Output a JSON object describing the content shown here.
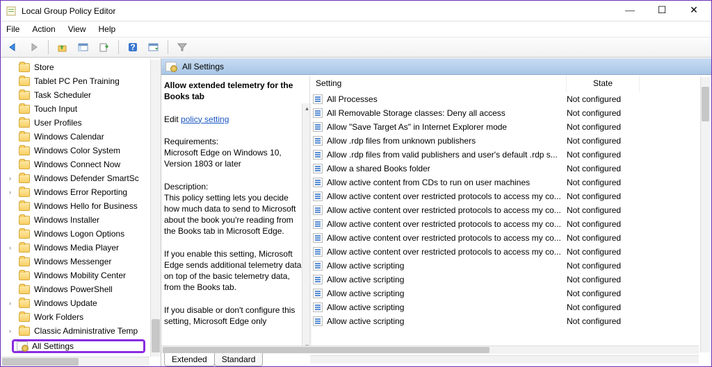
{
  "window": {
    "title": "Local Group Policy Editor"
  },
  "menu": {
    "file": "File",
    "action": "Action",
    "view": "View",
    "help": "Help"
  },
  "tree": {
    "items": [
      {
        "label": "Store",
        "exp": ""
      },
      {
        "label": "Tablet PC Pen Training",
        "exp": ""
      },
      {
        "label": "Task Scheduler",
        "exp": ""
      },
      {
        "label": "Touch Input",
        "exp": ""
      },
      {
        "label": "User Profiles",
        "exp": ""
      },
      {
        "label": "Windows Calendar",
        "exp": ""
      },
      {
        "label": "Windows Color System",
        "exp": ""
      },
      {
        "label": "Windows Connect Now",
        "exp": ""
      },
      {
        "label": "Windows Defender SmartSc",
        "exp": "›"
      },
      {
        "label": "Windows Error Reporting",
        "exp": "›"
      },
      {
        "label": "Windows Hello for Business",
        "exp": ""
      },
      {
        "label": "Windows Installer",
        "exp": ""
      },
      {
        "label": "Windows Logon Options",
        "exp": ""
      },
      {
        "label": "Windows Media Player",
        "exp": "›"
      },
      {
        "label": "Windows Messenger",
        "exp": ""
      },
      {
        "label": "Windows Mobility Center",
        "exp": ""
      },
      {
        "label": "Windows PowerShell",
        "exp": ""
      },
      {
        "label": "Windows Update",
        "exp": "›"
      },
      {
        "label": "Work Folders",
        "exp": ""
      },
      {
        "label": "Classic Administrative Temp",
        "exp": "›"
      }
    ],
    "selected": "All Settings"
  },
  "header": {
    "title": "All Settings"
  },
  "desc": {
    "policy_heading": "Allow extended telemetry for the Books tab",
    "edit_prefix": "Edit ",
    "edit_link": "policy setting",
    "req_label": "Requirements:",
    "req_text": "Microsoft Edge on Windows 10, Version 1803 or later",
    "desc_label": "Description:",
    "desc_text1": "This policy setting lets you decide how much data to send to Microsoft about the book you're reading from the Books tab in Microsoft Edge.",
    "desc_text2": "If you enable this setting, Microsoft Edge sends additional telemetry data, on top of the basic telemetry data, from the Books tab.",
    "desc_text3": "If you disable or don't configure this setting, Microsoft Edge only"
  },
  "list": {
    "col_setting": "Setting",
    "col_state": "State",
    "rows": [
      {
        "s": "All Processes",
        "st": "Not configured"
      },
      {
        "s": "All Removable Storage classes: Deny all access",
        "st": "Not configured"
      },
      {
        "s": "Allow \"Save Target As\" in Internet Explorer mode",
        "st": "Not configured"
      },
      {
        "s": "Allow .rdp files from unknown publishers",
        "st": "Not configured"
      },
      {
        "s": "Allow .rdp files from valid publishers and user's default .rdp s...",
        "st": "Not configured"
      },
      {
        "s": "Allow a shared Books folder",
        "st": "Not configured"
      },
      {
        "s": "Allow active content from CDs to run on user machines",
        "st": "Not configured"
      },
      {
        "s": "Allow active content over restricted protocols to access my co...",
        "st": "Not configured"
      },
      {
        "s": "Allow active content over restricted protocols to access my co...",
        "st": "Not configured"
      },
      {
        "s": "Allow active content over restricted protocols to access my co...",
        "st": "Not configured"
      },
      {
        "s": "Allow active content over restricted protocols to access my co...",
        "st": "Not configured"
      },
      {
        "s": "Allow active content over restricted protocols to access my co...",
        "st": "Not configured"
      },
      {
        "s": "Allow active scripting",
        "st": "Not configured"
      },
      {
        "s": "Allow active scripting",
        "st": "Not configured"
      },
      {
        "s": "Allow active scripting",
        "st": "Not configured"
      },
      {
        "s": "Allow active scripting",
        "st": "Not configured"
      },
      {
        "s": "Allow active scripting",
        "st": "Not configured"
      }
    ]
  },
  "tabs": {
    "extended": "Extended",
    "standard": "Standard"
  }
}
